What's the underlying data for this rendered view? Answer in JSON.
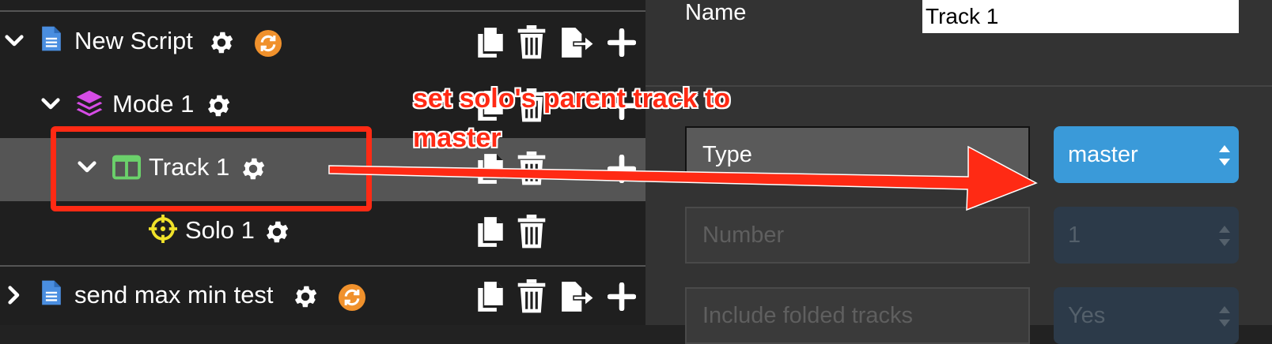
{
  "tree": {
    "rows": [
      {
        "label": "New Script"
      },
      {
        "label": "Mode 1"
      },
      {
        "label": "Track 1"
      },
      {
        "label": "Solo 1"
      },
      {
        "label": "send max min test"
      }
    ]
  },
  "properties": {
    "name_label": "Name",
    "name_value": "Track 1",
    "fields": [
      {
        "label": "Type",
        "value": "master"
      },
      {
        "label": "Number",
        "value": "1"
      },
      {
        "label": "Include folded tracks",
        "value": "Yes"
      }
    ]
  },
  "annotation": {
    "text_line1": "set solo's parent track to",
    "text_line2": "master"
  },
  "colors": {
    "script_icon": "#4a8ee0",
    "sync_badge": "#f0912c",
    "mode_icon": "#d64ce6",
    "track_icon": "#6bd16b",
    "solo_icon": "#f0e22a",
    "select_active": "#3a9ad9",
    "annotation_red": "#ff2a14"
  },
  "icons": {
    "expand": "chevron-down-icon",
    "collapsed": "chevron-right-icon",
    "script": "document-icon",
    "mode": "layers-icon",
    "track": "columns-icon",
    "solo": "crosshair-icon",
    "settings": "gear-icon",
    "sync": "sync-icon",
    "copy": "copy-icon",
    "delete": "trash-icon",
    "export": "export-icon",
    "add": "plus-icon"
  }
}
